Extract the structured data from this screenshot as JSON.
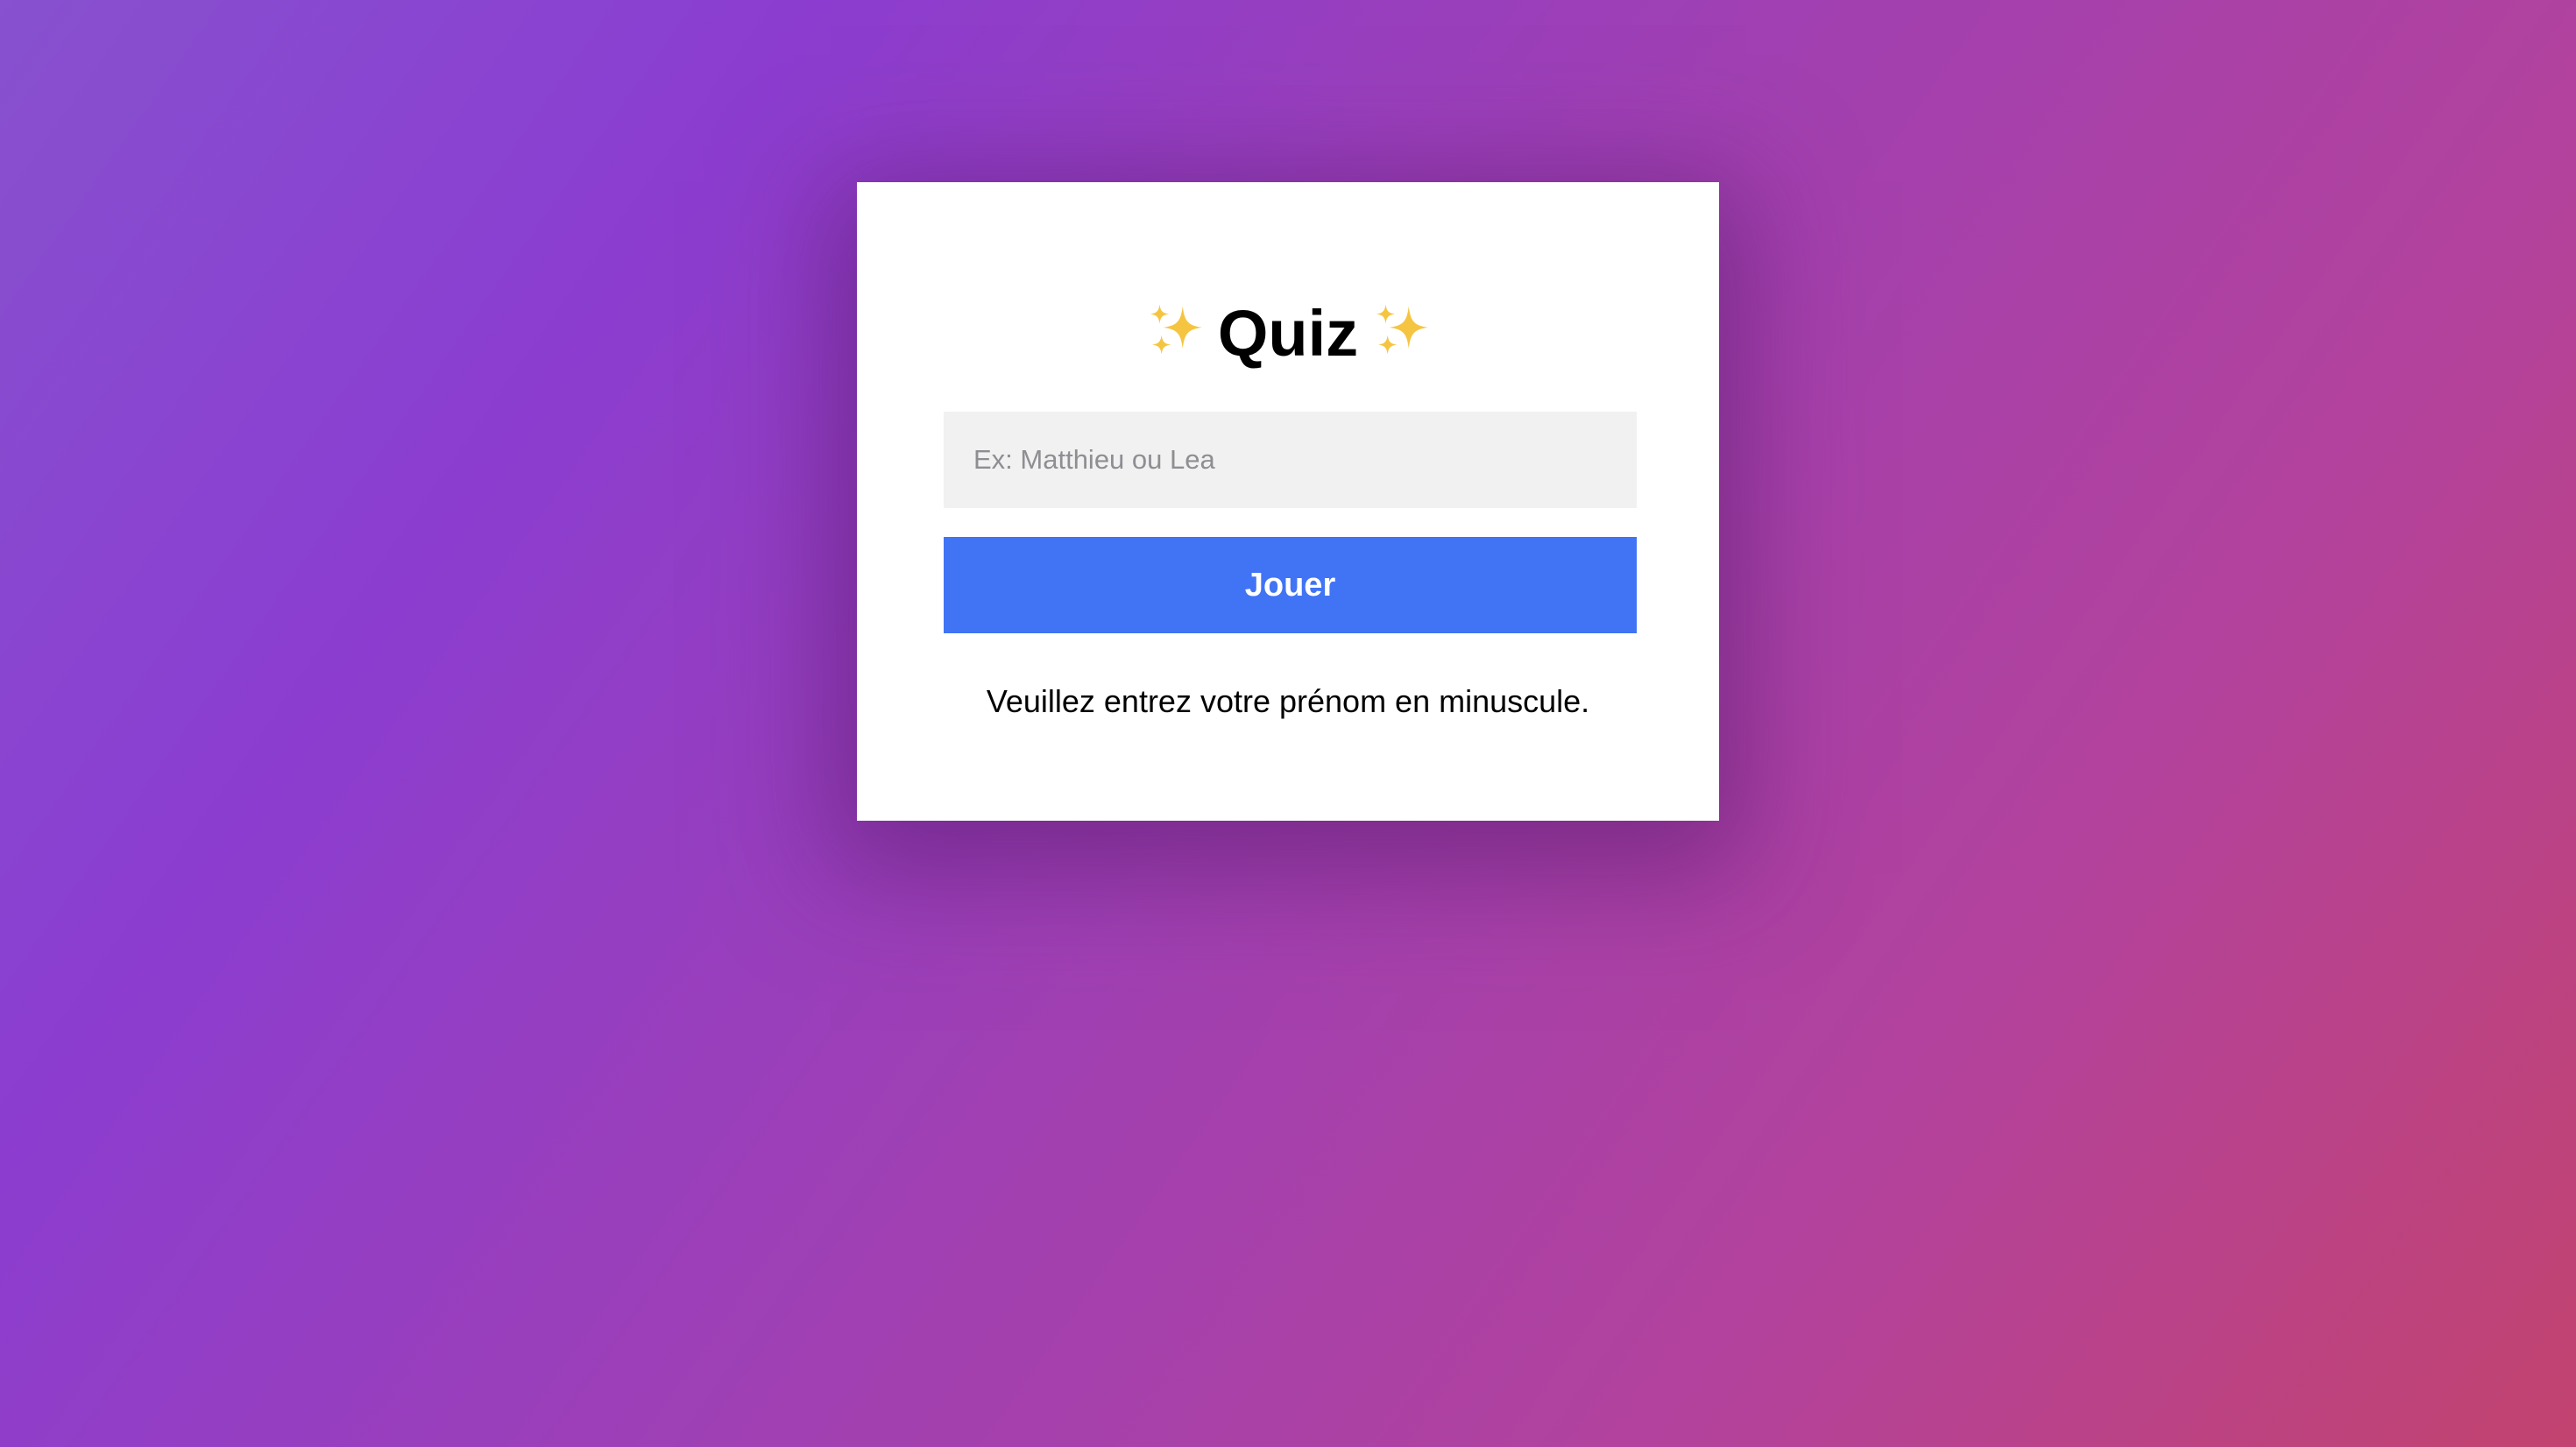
{
  "title": {
    "text": "Quiz",
    "decoration_icon": "sparkles-icon",
    "decoration_color": "#f5c542"
  },
  "form": {
    "name_input": {
      "value": "",
      "placeholder": "Ex: Matthieu ou Lea"
    },
    "play_button_label": "Jouer",
    "hint_text": "Veuillez entrez votre prénom en minuscule."
  },
  "colors": {
    "background_gradient": [
      "#8751cf",
      "#8b3dd0",
      "#a240b0",
      "#b3429c",
      "#c2436f"
    ],
    "card": "#ffffff",
    "button": "#4174f5",
    "input_background": "#f1f1f1"
  }
}
